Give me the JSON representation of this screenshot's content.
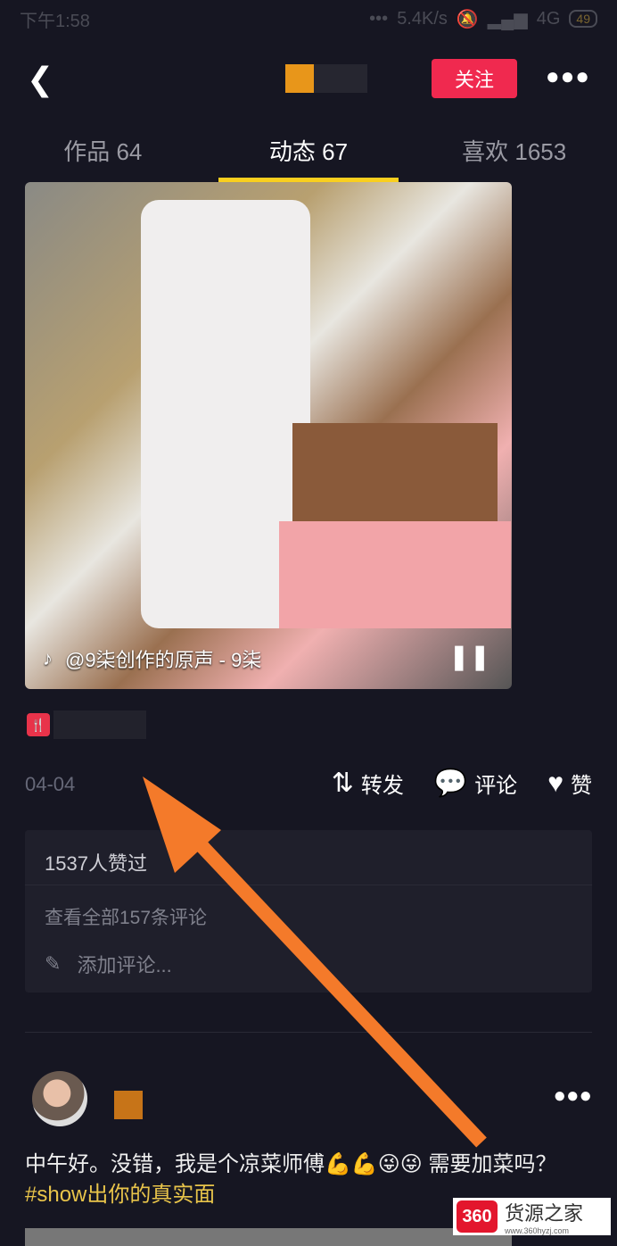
{
  "status_bar": {
    "time": "下午1:58",
    "speed": "5.4K/s",
    "network": "4G",
    "battery": "49"
  },
  "header": {
    "follow_label": "关注"
  },
  "tabs": [
    {
      "label": "作品 64"
    },
    {
      "label": "动态 67",
      "active": true
    },
    {
      "label": "喜欢 1653"
    }
  ],
  "video": {
    "music": "@9柒创作的原声 - 9柒"
  },
  "post": {
    "date": "04-04",
    "repost": "转发",
    "comment": "评论",
    "like": "赞"
  },
  "comments_panel": {
    "likes_text": "1537人赞过",
    "view_all": "查看全部157条评论",
    "add_placeholder": "添加评论..."
  },
  "next_post": {
    "text": "中午好。没错，我是个凉菜师傅💪💪😜😜 需要加菜吗？",
    "hashtag": "#show出你的真实面"
  },
  "watermark": {
    "logo": "360",
    "name": "货源之家",
    "url": "www.360hyzj.com"
  },
  "colors": {
    "accent": "#f0294f",
    "tab_indicator": "#f9cf1e",
    "arrow": "#f47a2a",
    "hashtag": "#e8c44a"
  }
}
